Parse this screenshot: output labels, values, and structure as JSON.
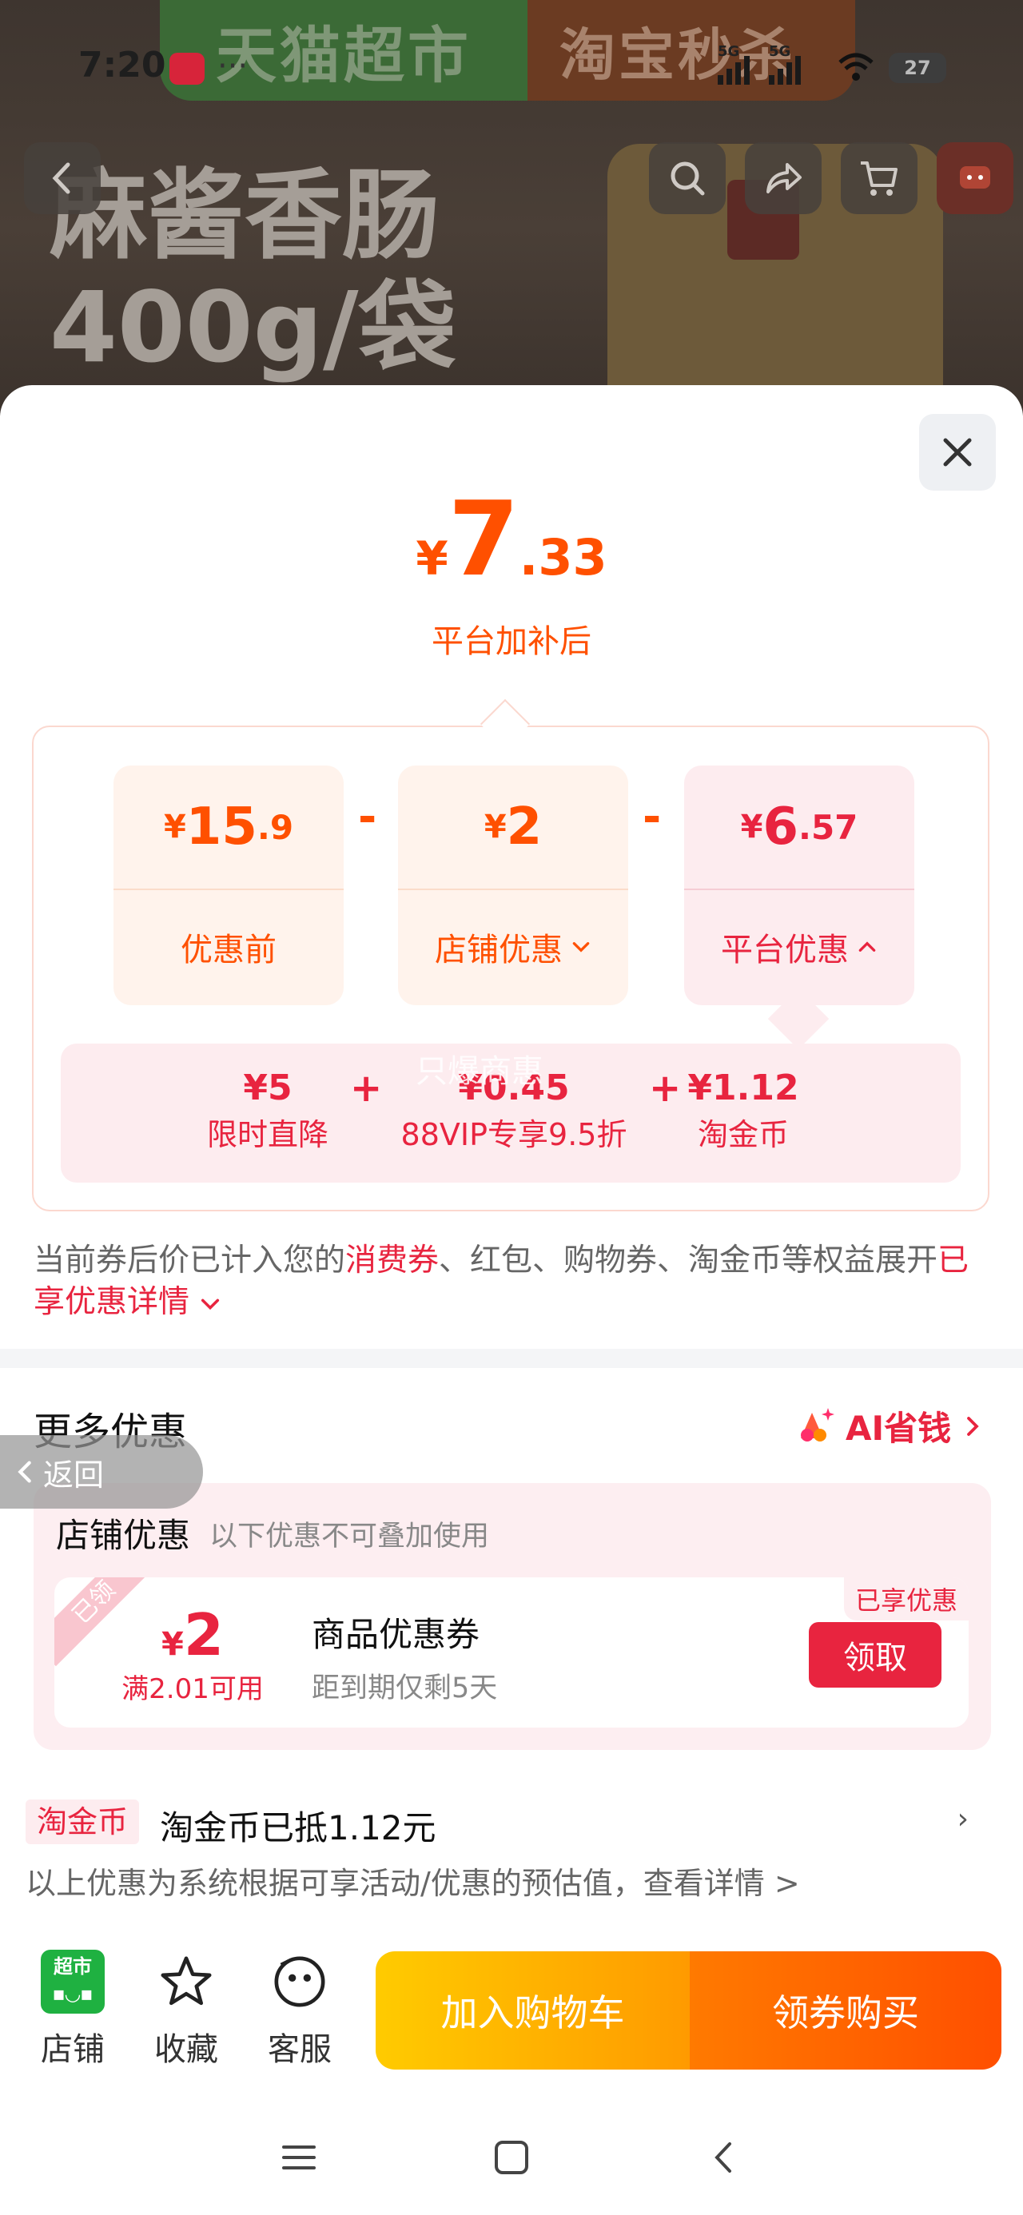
{
  "background_page": {
    "banner_left": "天猫超市",
    "banner_right": "淘宝秒杀",
    "product_title_line1": "麻酱香肠",
    "product_title_line2": "400g/袋"
  },
  "status_bar": {
    "time": "7:20",
    "signal1": "5G",
    "signal2": "5G",
    "battery": "27"
  },
  "price": {
    "currency": "¥",
    "integer": "7",
    "decimal": ".33",
    "subtitle": "平台加补后"
  },
  "breakdown": {
    "original": {
      "currency": "¥",
      "integer": "15",
      "decimal": ".9",
      "label": "优惠前"
    },
    "shop": {
      "currency": "¥",
      "integer": "2",
      "decimal": "",
      "label": "店铺优惠"
    },
    "platform": {
      "currency": "¥",
      "integer": "6",
      "decimal": ".57",
      "label": "平台优惠"
    },
    "minus": "-",
    "sub_items": [
      {
        "value": "¥5",
        "label": "限时直降"
      },
      {
        "value": "¥0.45",
        "label": "88VIP专享9.5折"
      },
      {
        "value": "¥1.12",
        "label": "淘金币"
      }
    ],
    "plus": "+",
    "watermark": "只爆商惠"
  },
  "note": {
    "part1": "当前券后价已计入您的",
    "highlight1": "消费券",
    "part2": "、红包、购物券、淘金币等权益展开",
    "highlight2": "已享优惠详情"
  },
  "more": {
    "title": "更多优惠",
    "ai_label": "AI省钱",
    "back_label": "返回"
  },
  "shop_discount": {
    "title": "店铺优惠",
    "hint": "以下优惠不可叠加使用",
    "coupon": {
      "ribbon": "已领",
      "currency": "¥",
      "amount": "2",
      "condition": "满2.01可用",
      "name": "商品优惠券",
      "expiry": "距到期仅剩5天",
      "tag": "已享优惠",
      "button": "领取"
    }
  },
  "coin": {
    "tag": "淘金币",
    "text": "淘金币已抵1.12元",
    "arrow": "›"
  },
  "estimate_note": "以上优惠为系统根据可享活动/优惠的预估值，查看详情 >",
  "bottom_bar": {
    "shop_logo_text": "超市",
    "shop": "店铺",
    "favorite": "收藏",
    "service": "客服",
    "add_to_cart": "加入购物车",
    "buy": "领券购买"
  },
  "colors": {
    "orange": "#ff5000",
    "red": "#e8243f"
  }
}
